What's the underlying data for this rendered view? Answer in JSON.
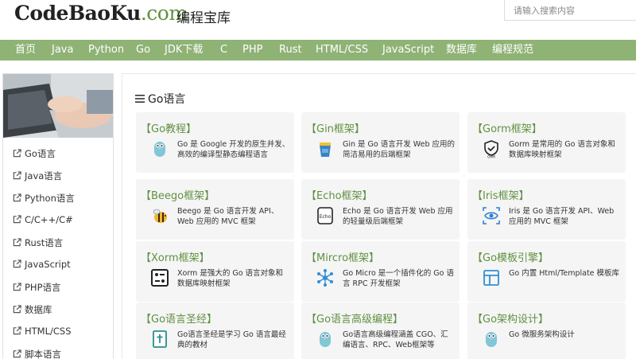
{
  "header": {
    "logo_main": "CodeBaoKu",
    "logo_tld": ".com",
    "logo_sub": "编程宝库",
    "search_placeholder": "请输入搜索内容"
  },
  "nav": [
    "首页",
    "Java",
    "Python",
    "Go",
    "JDK下载",
    "C",
    "PHP",
    "Rust",
    "HTML/CSS",
    "JavaScript",
    "数据库",
    "编程规范"
  ],
  "sidebar": {
    "items": [
      {
        "label": "Go语言",
        "icon": "external-link-icon"
      },
      {
        "label": "Java语言",
        "icon": "external-link-icon"
      },
      {
        "label": "Python语言",
        "icon": "external-link-icon"
      },
      {
        "label": "C/C++/C#",
        "icon": "external-link-icon"
      },
      {
        "label": "Rust语言",
        "icon": "external-link-icon"
      },
      {
        "label": "JavaScript",
        "icon": "external-link-icon"
      },
      {
        "label": "PHP语言",
        "icon": "external-link-icon"
      },
      {
        "label": "数据库",
        "icon": "external-link-icon"
      },
      {
        "label": "HTML/CSS",
        "icon": "external-link-icon"
      },
      {
        "label": "脚本语言",
        "icon": "external-link-icon"
      }
    ]
  },
  "main": {
    "title": "Go语言",
    "cards": [
      {
        "title": "【Go教程】",
        "desc": "Go 是 Google 开发的原生并发、高效的编译型静态编程语言",
        "icon": "gopher-icon"
      },
      {
        "title": "【Gin框架】",
        "desc": "Gin 是 Go 语言开发 Web 应用的简洁易用的后端框架",
        "icon": "gin-cup-icon"
      },
      {
        "title": "【Gorm框架】",
        "desc": "Gorm 是常用的 Go 语言对象和数据库映射框架",
        "icon": "gorm-shield-icon"
      },
      {
        "title": "【Beego框架】",
        "desc": "Beego 是 Go 语言开发 API、Web 应用的 MVC 框架",
        "icon": "bee-icon"
      },
      {
        "title": "【Echo框架】",
        "desc": "Echo 是 Go 语言开发 Web 应用的轻量级后端框架",
        "icon": "echo-icon"
      },
      {
        "title": "【Iris框架】",
        "desc": "Iris 是 Go 语言开发 API、Web 应用的 MVC 框架",
        "icon": "iris-eye-icon"
      },
      {
        "title": "【Xorm框架】",
        "desc": "Xorm 是强大的 Go 语言对象和数据库映射框架",
        "icon": "xorm-icon"
      },
      {
        "title": "【Mircro框架】",
        "desc": "Go Micro 是一个插件化的 Go 语言 RPC 开发框架",
        "icon": "micro-network-icon"
      },
      {
        "title": "【Go模板引擎】",
        "desc": "Go 内置 Html/Template 模板库",
        "icon": "template-layout-icon"
      },
      {
        "title": "【Go语言圣经】",
        "desc": "Go语言圣经是学习 Go 语言最经典的教材",
        "icon": "bible-book-icon"
      },
      {
        "title": "【Go语言高级编程】",
        "desc": "Go语言高级编程涵盖 CGO、汇编语言、RPC、Web框架等",
        "icon": "gopher-icon"
      },
      {
        "title": "【Go架构设计】",
        "desc": "Go 微服务架构设计",
        "icon": "gopher-icon"
      }
    ]
  },
  "colors": {
    "nav_bg": "#8fb275",
    "accent_green": "#5f9141",
    "card_bg": "#f5f5f5"
  }
}
